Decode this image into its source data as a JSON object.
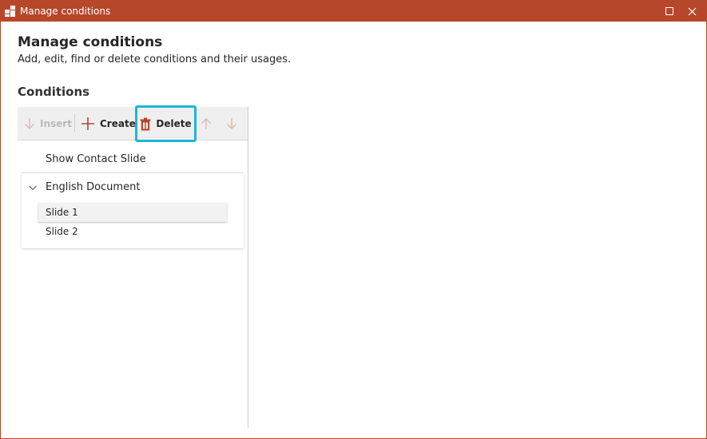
{
  "window": {
    "title": "Manage conditions",
    "accent_color": "#b7472a",
    "highlight_color": "#1fb4d9",
    "controls": [
      "maximize-icon",
      "close-icon"
    ]
  },
  "header": {
    "title": "Manage conditions",
    "subtitle": "Add, edit, find or delete conditions and their usages."
  },
  "conditions": {
    "section_title": "Conditions",
    "toolbar": {
      "insert_label": "Insert",
      "create_label": "Create",
      "delete_label": "Delete",
      "icons": [
        "arrow-down-icon",
        "plus-icon",
        "trash-icon",
        "arrow-up-icon",
        "arrow-down-icon"
      ]
    },
    "items": [
      {
        "label": "Show Contact Slide"
      },
      {
        "label": "English Document",
        "expanded": true,
        "children": [
          {
            "label": "Slide 1",
            "selected": true
          },
          {
            "label": "Slide 2",
            "selected": false
          }
        ]
      }
    ]
  }
}
